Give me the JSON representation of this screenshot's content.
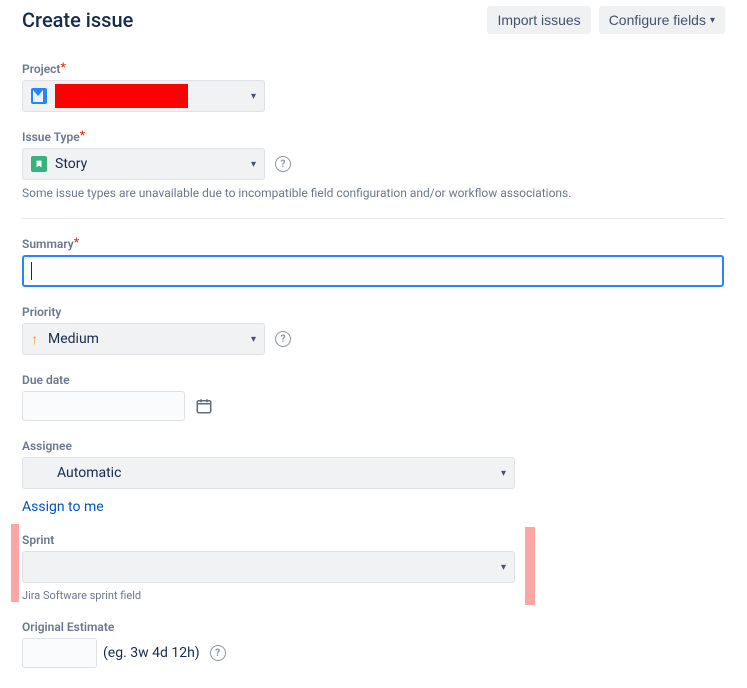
{
  "header": {
    "title": "Create issue",
    "import_btn": "Import issues",
    "configure_btn": "Configure fields"
  },
  "project": {
    "label": "Project",
    "value": ""
  },
  "issue_type": {
    "label": "Issue Type",
    "value": "Story",
    "hint": "Some issue types are unavailable due to incompatible field configuration and/or workflow associations."
  },
  "summary": {
    "label": "Summary",
    "value": ""
  },
  "priority": {
    "label": "Priority",
    "value": "Medium"
  },
  "due_date": {
    "label": "Due date",
    "value": ""
  },
  "assignee": {
    "label": "Assignee",
    "value": "Automatic",
    "assign_to_me": "Assign to me"
  },
  "sprint": {
    "label": "Sprint",
    "value": "",
    "desc": "Jira Software sprint field"
  },
  "original_estimate": {
    "label": "Original Estimate",
    "example": "(eg. 3w 4d 12h)"
  }
}
